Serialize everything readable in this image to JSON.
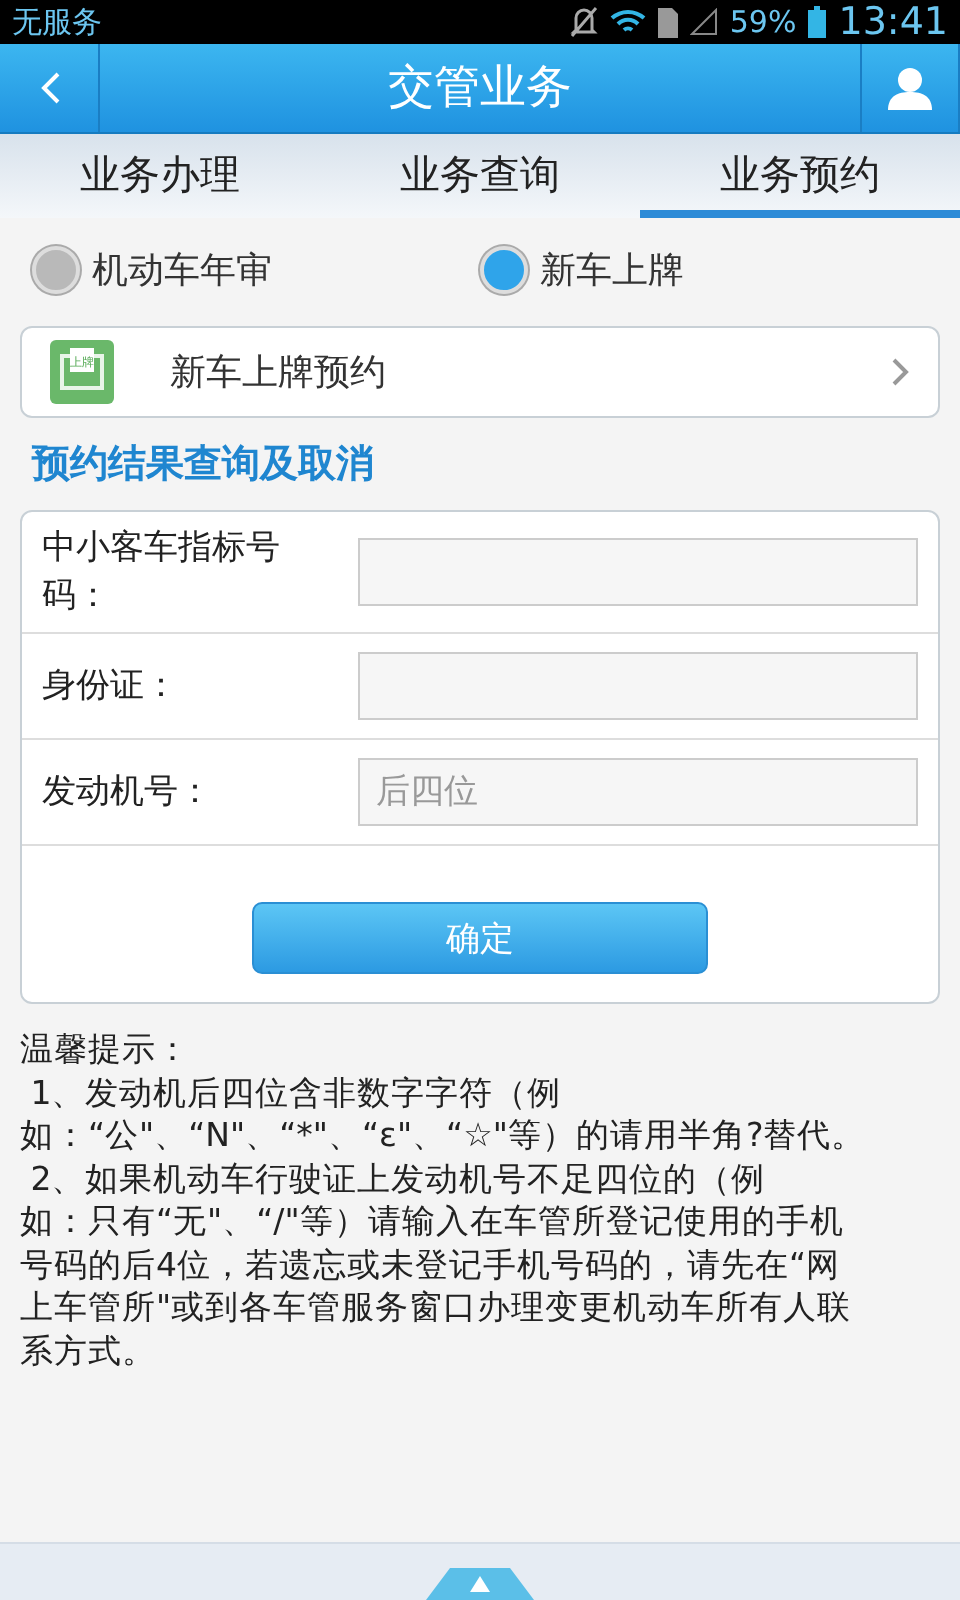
{
  "status_bar": {
    "carrier": "无服务",
    "battery": "59%",
    "time": "13:41"
  },
  "header": {
    "title": "交管业务"
  },
  "tabs": [
    {
      "label": "业务办理",
      "selected": false
    },
    {
      "label": "业务查询",
      "selected": false
    },
    {
      "label": "业务预约",
      "selected": true
    }
  ],
  "radios": [
    {
      "label": "机动车年审",
      "selected": false
    },
    {
      "label": "新车上牌",
      "selected": true
    }
  ],
  "booking_item": {
    "icon_text": "上牌",
    "label": "新车上牌预约"
  },
  "section_title": "预约结果查询及取消",
  "form": {
    "fields": [
      {
        "label": "中小客车指标号码："
      },
      {
        "label": "身份证："
      },
      {
        "label": "发动机号：",
        "placeholder": "后四位"
      }
    ],
    "submit": "确定"
  },
  "notes": [
    "温馨提示：",
    " 1、发动机后四位含非数字字符（例",
    "如：“公\"、“N\"、“*\"、“ε\"、“☆\"等）的请用半角?替代。",
    " 2、如果机动车行驶证上发动机号不足四位的（例",
    "如：只有“无\"、“/\"等）请输入在车管所登记使用的手机",
    "号码的后4位，若遗忘或未登记手机号码的，请先在“网",
    "上车管所\"或到各车管服务窗口办理变更机动车所有人联",
    "系方式。"
  ]
}
